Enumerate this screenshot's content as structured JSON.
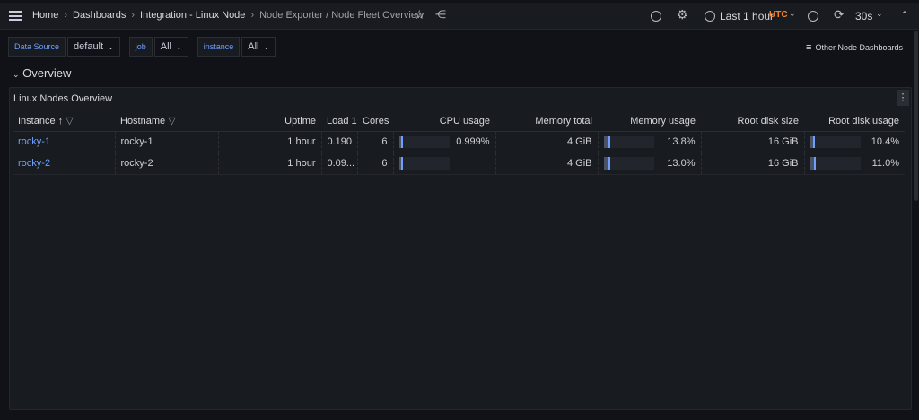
{
  "breadcrumb": [
    "Home",
    "Dashboards",
    "Integration - Linux Node",
    "Node Exporter / Node Fleet Overview"
  ],
  "toolbar": {
    "time_range": "Last 1 hour",
    "timezone": "UTC",
    "refresh": "30s"
  },
  "variables": [
    {
      "label": "Data Source",
      "value": "default"
    },
    {
      "label": "job",
      "value": "All"
    },
    {
      "label": "instance",
      "value": "All"
    }
  ],
  "links": {
    "other": "Other Node Dashboards"
  },
  "row": {
    "title": "Overview"
  },
  "panel": {
    "title": "Linux Nodes Overview",
    "columns": [
      "Instance",
      "Hostname",
      "Uptime",
      "Load 1",
      "Cores",
      "CPU usage",
      "Memory total",
      "Memory usage",
      "Root disk size",
      "Root disk usage"
    ],
    "rows": [
      {
        "instance": "rocky-1",
        "hostname": "rocky-1",
        "uptime": "1 hour",
        "load": "0.190",
        "cores": "6",
        "cpu": "0.999%",
        "cpu_pct": 0.999,
        "mem_total": "4 GiB",
        "mem_usage": "13.8%",
        "mem_pct": 13.8,
        "disk_size": "16 GiB",
        "disk_usage": "10.4%",
        "disk_pct": 10.4
      },
      {
        "instance": "rocky-2",
        "hostname": "rocky-2",
        "uptime": "1 hour",
        "load": "0.09...",
        "cores": "6",
        "cpu": "",
        "cpu_pct": 0.9,
        "mem_total": "4 GiB",
        "mem_usage": "13.0%",
        "mem_pct": 13.0,
        "disk_size": "16 GiB",
        "disk_usage": "11.0%",
        "disk_pct": 11.0
      }
    ]
  },
  "colors": {
    "accent": "#6e9fff",
    "utc": "#f5822a"
  }
}
